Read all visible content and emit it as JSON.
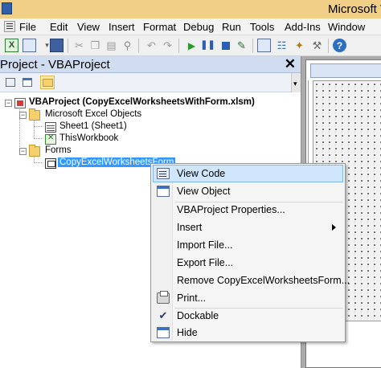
{
  "window": {
    "title": "Microsoft V"
  },
  "menu": [
    "File",
    "Edit",
    "View",
    "Insert",
    "Format",
    "Debug",
    "Run",
    "Tools",
    "Add-Ins",
    "Window"
  ],
  "toolbar": {
    "icons": [
      "excel-icon",
      "insert-userform-icon",
      "save-icon",
      "cut-icon",
      "copy-icon",
      "paste-icon",
      "find-icon",
      "undo-icon",
      "redo-icon",
      "run-icon",
      "break-icon",
      "reset-icon",
      "design-mode-icon",
      "project-explorer-icon",
      "properties-icon",
      "object-browser-icon",
      "toolbox-icon",
      "help-icon"
    ]
  },
  "project_pane": {
    "title": "Project - VBAProject",
    "close": "✕",
    "tree": {
      "project": "VBAProject (CopyExcelWorksheetsWithForm.xlsm)",
      "excel_objects_folder": "Microsoft Excel Objects",
      "sheet1": "Sheet1 (Sheet1)",
      "thisworkbook": "ThisWorkbook",
      "forms_folder": "Forms",
      "form": "CopyExcelWorksheetsForm",
      "expanded_glyph": "−"
    }
  },
  "context_menu": {
    "items": [
      {
        "label": "View Code",
        "icon": "view-code-icon",
        "highlighted": true
      },
      {
        "label": "View Object",
        "icon": "view-object-icon"
      },
      {
        "label": "VBAProject Properties..."
      },
      {
        "label": "Insert",
        "submenu": true
      },
      {
        "label": "Import File..."
      },
      {
        "label": "Export File..."
      },
      {
        "label": "Remove CopyExcelWorksheetsForm..."
      },
      {
        "label": "Print...",
        "icon": "print-icon"
      },
      {
        "label": "Dockable",
        "icon": "checkmark-icon",
        "checked": true
      },
      {
        "label": "Hide",
        "icon": "hide-icon"
      }
    ],
    "check_glyph": "✔"
  },
  "colors": {
    "title_bar": "#f2cf86",
    "selection": "#3399ff",
    "menu_highlight": "#cfe6fc"
  }
}
